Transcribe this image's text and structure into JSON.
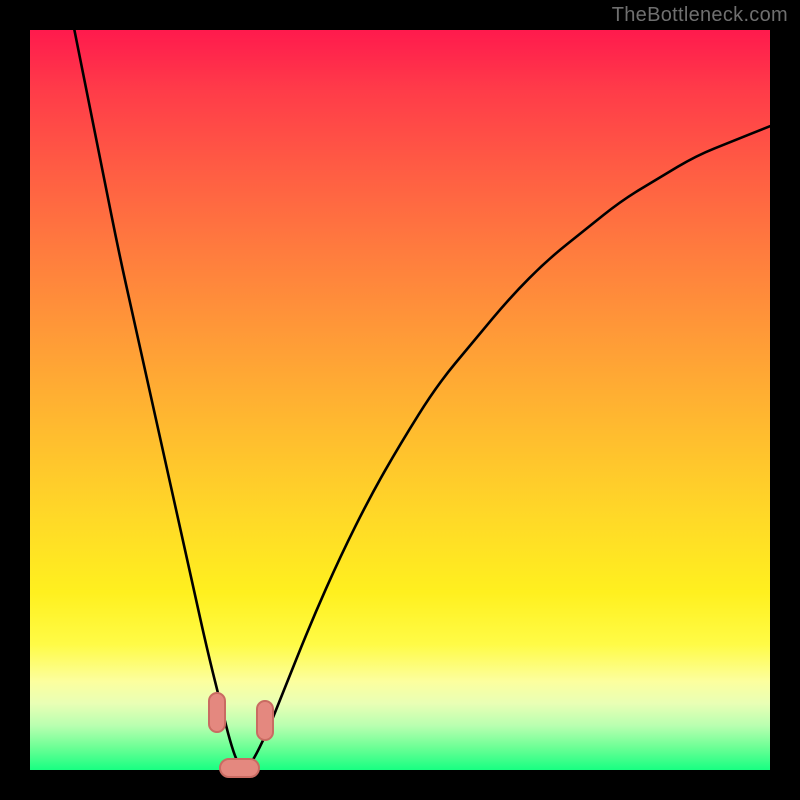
{
  "watermark": "TheBottleneck.com",
  "colors": {
    "frame": "#000000",
    "gradient_top": "#ff1a4d",
    "gradient_bottom": "#18ff82",
    "curve": "#000000",
    "blob_fill": "#e4887f",
    "blob_stroke": "#c96b62"
  },
  "chart_data": {
    "type": "line",
    "title": "",
    "xlabel": "",
    "ylabel": "",
    "xlim": [
      0,
      100
    ],
    "ylim": [
      0,
      100
    ],
    "note": "V-shaped bottleneck curve. y is mismatch/bottleneck percentage; low y near the green band means balanced. Minimum occurs around x≈26–30.",
    "series": [
      {
        "name": "bottleneck-curve",
        "x": [
          6,
          8,
          10,
          12,
          14,
          16,
          18,
          20,
          22,
          24,
          26,
          27,
          28,
          29,
          30,
          32,
          34,
          38,
          42,
          46,
          50,
          55,
          60,
          65,
          70,
          75,
          80,
          85,
          90,
          95,
          100
        ],
        "y": [
          100,
          90,
          80,
          70,
          61,
          52,
          43,
          34,
          25,
          16,
          8,
          4,
          1,
          0,
          1,
          5,
          10,
          20,
          29,
          37,
          44,
          52,
          58,
          64,
          69,
          73,
          77,
          80,
          83,
          85,
          87
        ]
      }
    ],
    "markers": [
      {
        "name": "left-slope-marker",
        "x": 25.0,
        "y": 8,
        "w": 2.0,
        "h": 5
      },
      {
        "name": "right-slope-marker",
        "x": 31.5,
        "y": 7,
        "w": 2.0,
        "h": 5
      },
      {
        "name": "valley-marker",
        "x": 28.0,
        "y": 0.5,
        "w": 5.0,
        "h": 2.2
      }
    ]
  }
}
